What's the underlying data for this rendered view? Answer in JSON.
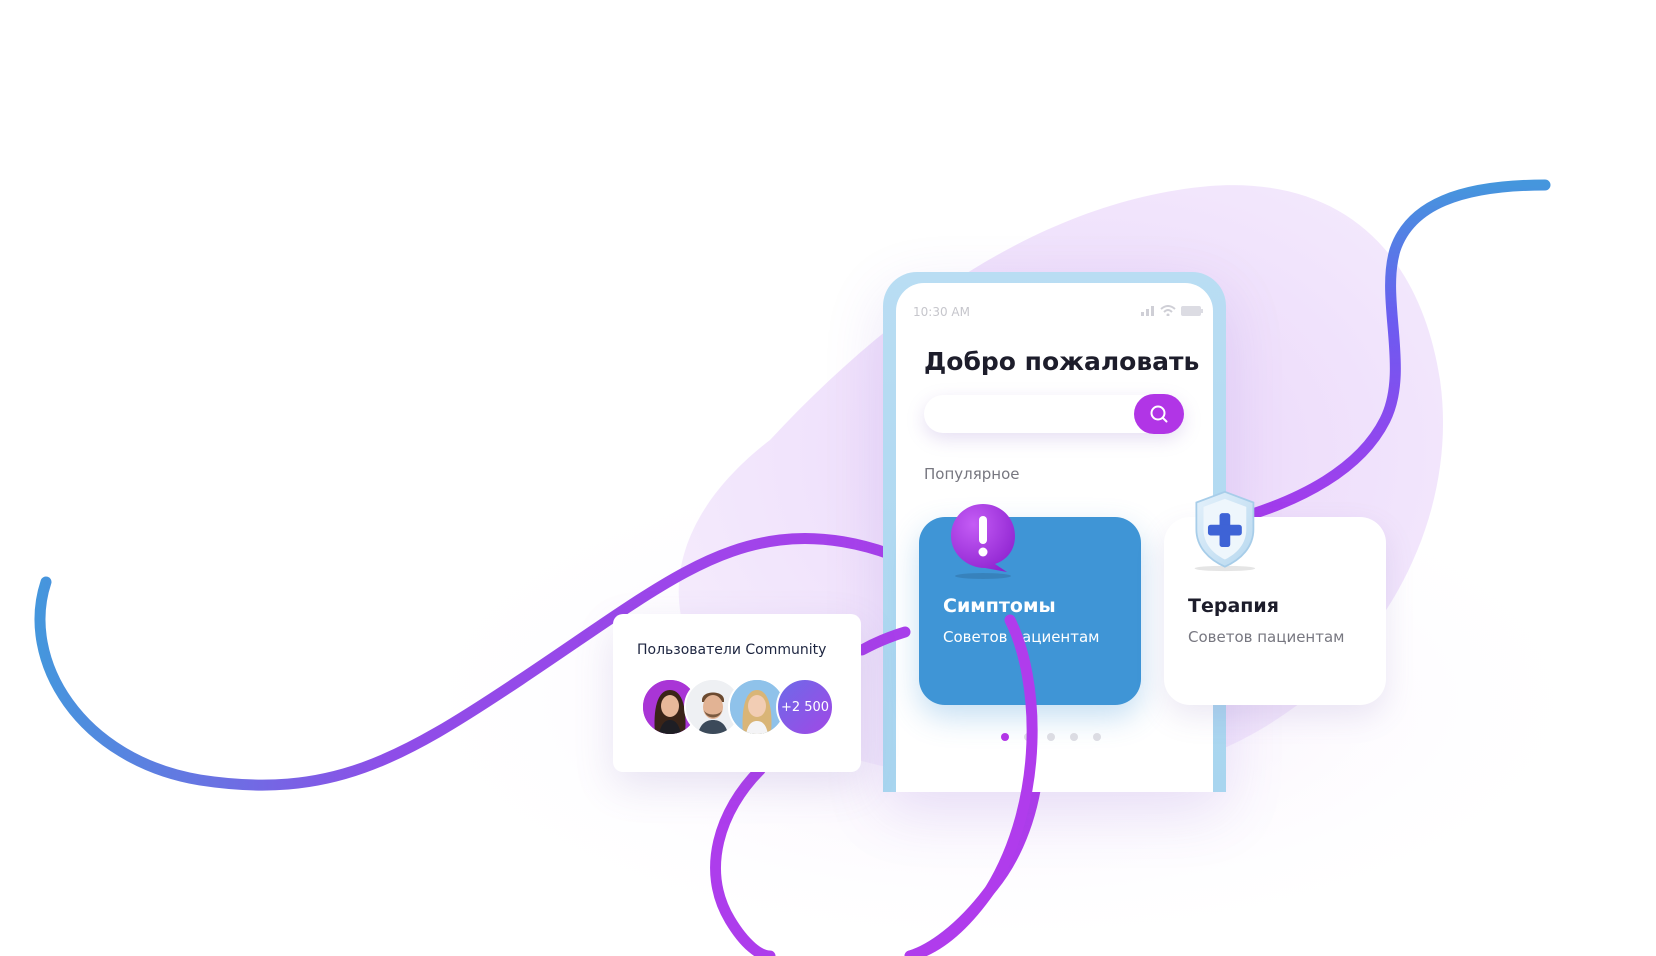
{
  "colors": {
    "accent": "#b135e6",
    "card_blue": "#3f95d6",
    "curve_start": "#4596dd",
    "curve_end": "#a63bec",
    "blob": "#f1e3fb"
  },
  "status_bar": {
    "time": "10:30 AM",
    "icons": [
      "signal-icon",
      "wifi-icon",
      "battery-icon"
    ]
  },
  "app": {
    "title": "Добро пожаловать",
    "search": {
      "placeholder": "",
      "value": "",
      "button_icon": "search-icon"
    },
    "section_label": "Популярное",
    "cards": [
      {
        "title": "Симптомы",
        "subtitle": "Советов пациентам",
        "icon": "exclamation-bubble-icon",
        "color": "#3f95d6"
      },
      {
        "title": "Терапия",
        "subtitle": "Советов пациентам",
        "icon": "medical-shield-icon",
        "color": "#ffffff"
      }
    ],
    "pagination": {
      "pages": 5,
      "active": 1
    }
  },
  "community": {
    "title": "Пользователи Community",
    "extra_count": "+2 500",
    "avatars": [
      "avatar-woman-dark-hair",
      "avatar-man-beard",
      "avatar-woman-blonde"
    ]
  }
}
